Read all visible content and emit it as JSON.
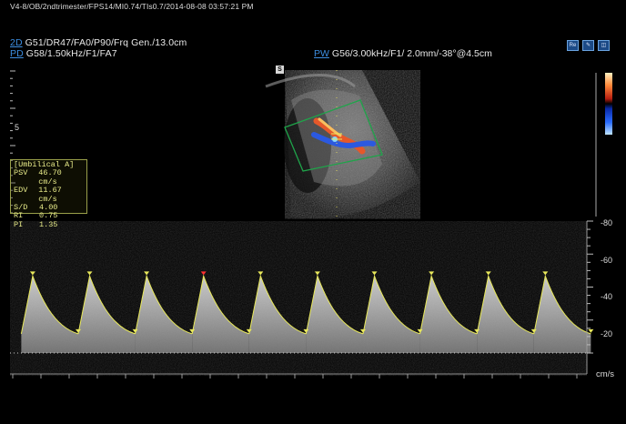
{
  "header": {
    "line1": "V4-8/OB/2ndtrimester/FPS14/MI0.74/TIs0.7/2014-08-08 03:57:21 PM",
    "mode_2d": "2D",
    "line_2d": "G51/DR47/FA0/P90/Frq Gen./13.0cm",
    "mode_pd": "PD",
    "line_pd": "G58/1.50kHz/F1/FA7",
    "mode_pw": "PW",
    "line_pw": "G56/3.00kHz/F1/ 2.0mm/-38°@4.5cm"
  },
  "icons": [
    "ruler-icon",
    "measure-icon",
    "sample-gate-icon"
  ],
  "image_marker": "S",
  "depth_label": "5",
  "measurement": {
    "title": "[Umbilical A]",
    "rows": [
      {
        "k": "PSV",
        "v": "46.70 cm/s"
      },
      {
        "k": "EDV",
        "v": "11.67 cm/s"
      },
      {
        "k": "S/D",
        "v": "4.00"
      },
      {
        "k": "RI",
        "v": "0.75"
      },
      {
        "k": "PI",
        "v": "1.35"
      }
    ]
  },
  "velocity_scale": {
    "ticks": [
      "-80",
      "-60",
      "-40",
      "-20"
    ],
    "unit": "cm/s"
  },
  "colors": {
    "mode_blue": "#3d8ee0",
    "trace_yellow": "#e8e85a",
    "sector_green": "#1fa44a",
    "measure_text": "#e9ec8a"
  },
  "spectral": {
    "beats": 10,
    "peak_cm_s": 46.7,
    "end_diastolic_cm_s": 11.67,
    "baseline_cm_s": 0
  }
}
